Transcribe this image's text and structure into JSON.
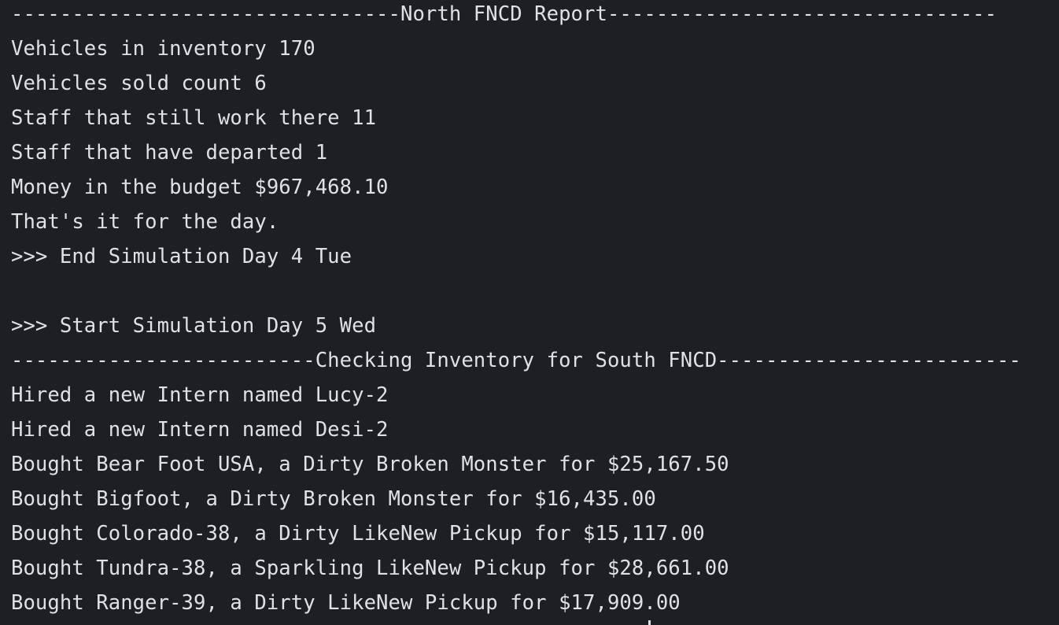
{
  "console": {
    "lines": [
      "--------------------------------North FNCD Report--------------------------------",
      "Vehicles in inventory 170",
      "Vehicles sold count 6",
      "Staff that still work there 11",
      "Staff that have departed 1",
      "Money in the budget $967,468.10",
      "That's it for the day.",
      ">>> End Simulation Day 4 Tue",
      "",
      ">>> Start Simulation Day 5 Wed",
      "-------------------------Checking Inventory for South FNCD-------------------------",
      "Hired a new Intern named Lucy-2",
      "Hired a new Intern named Desi-2",
      "Bought Bear Foot USA, a Dirty Broken Monster for $25,167.50",
      "Bought Bigfoot, a Dirty Broken Monster for $16,435.00",
      "Bought Colorado-38, a Dirty LikeNew Pickup for $15,117.00",
      "Bought Tundra-38, a Sparkling LikeNew Pickup for $28,661.00",
      "Bought Ranger-39, a Dirty LikeNew Pickup for $17,909.00"
    ]
  }
}
